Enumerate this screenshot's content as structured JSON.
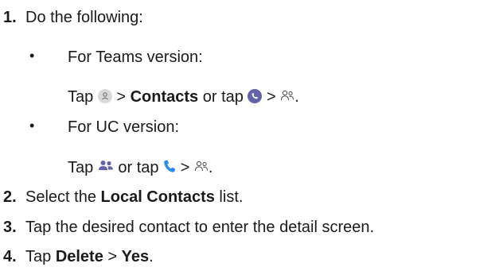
{
  "steps": [
    {
      "num": "1.",
      "text": "Do the following:"
    },
    {
      "num": "2.",
      "pre": "Select the ",
      "bold": "Local Contacts",
      "post": " list."
    },
    {
      "num": "3.",
      "text": "Tap the desired contact to enter the detail screen."
    },
    {
      "num": "4.",
      "pre": "Tap ",
      "bold1": "Delete",
      "mid": " > ",
      "bold2": "Yes",
      "post": "."
    }
  ],
  "teams": {
    "bullet": "•",
    "heading": "For Teams version:",
    "tap": "Tap",
    "gt1": " > ",
    "contacts": "Contacts",
    "or_tap": " or tap ",
    "gt2": " > ",
    "end": "."
  },
  "uc": {
    "bullet": "•",
    "heading": "For UC version:",
    "tap": "Tap",
    "or_tap": " or tap ",
    "gt": " > ",
    "end": "."
  },
  "icons": {
    "avatar": "person-avatar-icon",
    "calls": "calls-icon",
    "contacts": "contacts-outline-icon",
    "people": "people-icon",
    "phone": "phone-icon"
  },
  "colors": {
    "purple": "#6264a7",
    "blue": "#2a8be8",
    "gray_circle": "#d9d9d9"
  }
}
